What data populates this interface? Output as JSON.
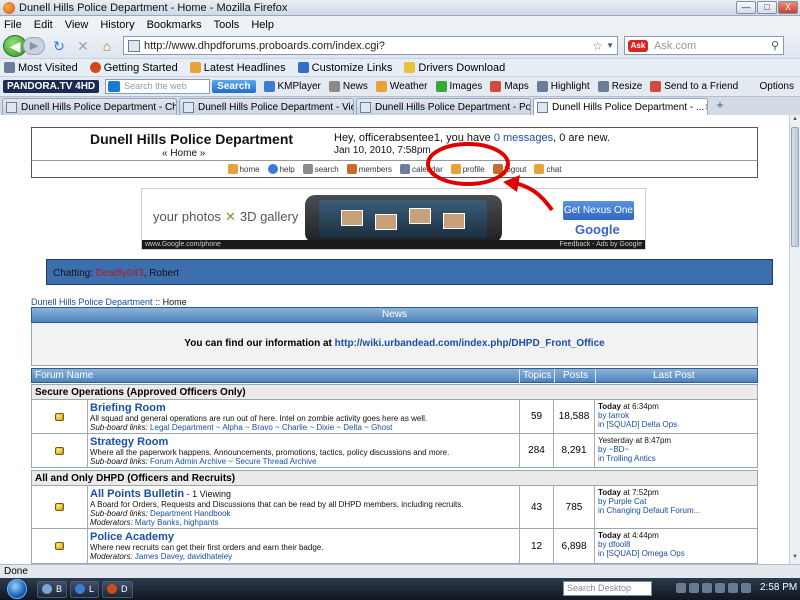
{
  "window": {
    "title": "Dunell Hills Police Department - Home - Mozilla Firefox",
    "controls": {
      "minimize": "—",
      "maximize": "□",
      "close": "X"
    }
  },
  "menubar": [
    "File",
    "Edit",
    "View",
    "History",
    "Bookmarks",
    "Tools",
    "Help"
  ],
  "navbar": {
    "url": "http://www.dhpdforums.proboards.com/index.cgi?",
    "search_placeholder": "Ask.com",
    "icons": [
      "back-arrow-icon",
      "forward-arrow-icon",
      "reload-icon",
      "stop-icon",
      "home-icon",
      "star-icon",
      "magnifier-icon"
    ]
  },
  "bookmarks": [
    {
      "label": "Most Visited",
      "color": "#6b7d98"
    },
    {
      "label": "Getting Started",
      "color": "#d2491b"
    },
    {
      "label": "Latest Headlines",
      "color": "#e8a23a"
    },
    {
      "label": "Customize Links",
      "color": "#2f6fc8"
    },
    {
      "label": "Drivers Download",
      "color": "#e8c33a"
    }
  ],
  "toolbar2": {
    "pandora": "PANDORA.TV 4HD",
    "search_placeholder": "Search the web",
    "search_btn": "Search",
    "items": [
      {
        "label": "KMPlayer",
        "color": "#3a7bd5"
      },
      {
        "label": "News",
        "color": "#8a8a8a"
      },
      {
        "label": "Weather",
        "color": "#e8a23a"
      },
      {
        "label": "Images",
        "color": "#3aa83a"
      },
      {
        "label": "Maps",
        "color": "#d24a3a"
      },
      {
        "label": "Highlight",
        "color": "#6b7d98"
      },
      {
        "label": "Resize",
        "color": "#6b7d98"
      },
      {
        "label": "Send to a Friend",
        "color": "#d24a3a"
      }
    ],
    "options": "Options"
  },
  "tabs": [
    {
      "label": "Dunell Hills Police Department - Ch..."
    },
    {
      "label": "Dunell Hills Police Department - Vie..."
    },
    {
      "label": "Dunell Hills Police Department - Po..."
    },
    {
      "label": "Dunell Hills Police Department - ..."
    }
  ],
  "header": {
    "site_title": "Dunell Hills Police Department",
    "home_crumb": "« Home »",
    "greet_prefix": "Hey, officerabsentee1, you have ",
    "greet_link": "0 messages",
    "greet_suffix": ", 0 are new.",
    "datetime": "Jan 10, 2010, 7:58pm"
  },
  "nav_items": [
    {
      "label": "home",
      "color": "#e8a23a"
    },
    {
      "label": "help",
      "color": "#3a7bd5"
    },
    {
      "label": "search",
      "color": "#8a8a8a"
    },
    {
      "label": "members",
      "color": "#c66b2a"
    },
    {
      "label": "calendar",
      "color": "#6b7d98"
    },
    {
      "label": "profile",
      "color": "#e8a23a"
    },
    {
      "label": "logout",
      "color": "#c66b2a"
    },
    {
      "label": "chat",
      "color": "#e8a23a"
    }
  ],
  "ad": {
    "text1": "your photos",
    "text2": "3D gallery",
    "cta": "Get Nexus One",
    "brand": "Google",
    "footer_left": "www.Google.com/phone",
    "footer_right": "Feedback - Ads by Google"
  },
  "chat": {
    "prefix": "Chatting: ",
    "user1": "Deadly043",
    "sep": ", ",
    "user2": "Robert"
  },
  "crumb": {
    "link": "Dunell Hills Police Department",
    "rest": " :: Home"
  },
  "news": {
    "title": "News",
    "prefix": "You can find our information at ",
    "link": "http://wiki.urbandead.com/index.php/DHPD_Front_Office"
  },
  "forum_headers": {
    "name": "Forum Name",
    "topics": "Topics",
    "posts": "Posts",
    "last": "Last Post"
  },
  "categories": [
    {
      "title": "Secure Operations (Approved Officers Only)",
      "forums": [
        {
          "name": "Briefing Room",
          "viewing": "",
          "desc": "All squad and general operations are run out of here. Intel on zombie activity goes here as well.",
          "sub_label": "Sub-board links:",
          "sub": "Legal Department ~ Alpha ~ Bravo ~ Charlie ~ Dixie ~ Delta ~ Ghost",
          "topics": "59",
          "posts": "18,588",
          "last_when_bold": "Today",
          "last_when": " at 6:34pm",
          "last_by": "by tarrok",
          "last_in": "in [SQUAD] Delta Ops"
        },
        {
          "name": "Strategy Room",
          "viewing": "",
          "desc": "Where all the paperwork happens. Announcements, promotions, tactics, policy discussions and more.",
          "sub_label": "Sub-board links:",
          "sub": "Forum Admin Archive ~ Secure Thread Archive",
          "topics": "284",
          "posts": "8,291",
          "last_when_bold": "",
          "last_when": "Yesterday at 8:47pm",
          "last_by": "by ~BD~",
          "last_in": "in Trolling Antics"
        }
      ]
    },
    {
      "title": "All and Only DHPD (Officers and Recruits)",
      "forums": [
        {
          "name": "All Points Bulletin",
          "viewing": " - 1 Viewing",
          "desc": "A Board for Orders, Requests and Discussions that can be read by all DHPD members, including recruits.",
          "sub_label": "Sub-board links:",
          "sub": "Department Handbook",
          "mod_label": "Moderators:",
          "mods": "Marty Banks, highpants",
          "topics": "43",
          "posts": "785",
          "last_when_bold": "Today",
          "last_when": " at 7:52pm",
          "last_by": "by Purple Cat",
          "last_in": "in Changing Default Forum..."
        },
        {
          "name": "Police Academy",
          "viewing": "",
          "desc": "Where new recruits can get their first orders and earn their badge.",
          "mod_label": "Moderators:",
          "mods": "James Davey, davidhateley",
          "topics": "12",
          "posts": "6,898",
          "last_when_bold": "Today",
          "last_when": " at 4:44pm",
          "last_by": "by dfool8",
          "last_in": "in [SQUAD] Omega Ops"
        }
      ]
    }
  ],
  "status": "Done",
  "taskbar": {
    "btn1": "B",
    "btn2": "L",
    "btn3": "D",
    "desktop_search": "Search Desktop",
    "clock": "2:58 PM"
  },
  "annotation_color": "#e00000"
}
